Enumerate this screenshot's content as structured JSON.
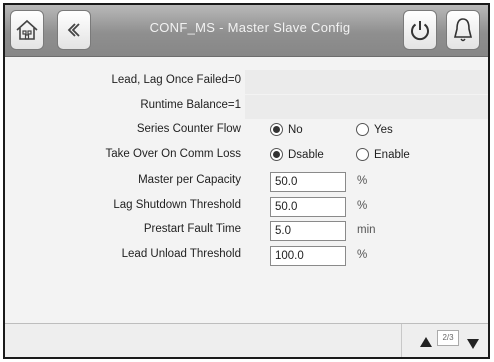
{
  "header": {
    "title": "CONF_MS  - Master Slave Config"
  },
  "rows": [
    {
      "label": "Lead, Lag Once Failed=0"
    },
    {
      "label": "Runtime Balance=1"
    },
    {
      "label": "Series Counter Flow",
      "options": [
        "No",
        "Yes"
      ],
      "selected": "No"
    },
    {
      "label": "Take Over On Comm Loss",
      "options": [
        "Dsable",
        "Enable"
      ],
      "selected": "Dsable"
    },
    {
      "label": "Master per Capacity",
      "value": "50.0",
      "unit": "%"
    },
    {
      "label": "Lag Shutdown Threshold",
      "value": "50.0",
      "unit": "%"
    },
    {
      "label": "Prestart Fault Time",
      "value": "5.0",
      "unit": "min"
    },
    {
      "label": "Lead Unload Threshold",
      "value": "100.0",
      "unit": "%"
    }
  ],
  "footer": {
    "page_indicator": "2/3"
  },
  "icons": {
    "home": "home-icon",
    "back": "chevron-left-icon",
    "power": "power-icon",
    "alarm": "bell-icon",
    "page_up": "triangle-up-icon",
    "page_down": "triangle-down-icon"
  }
}
